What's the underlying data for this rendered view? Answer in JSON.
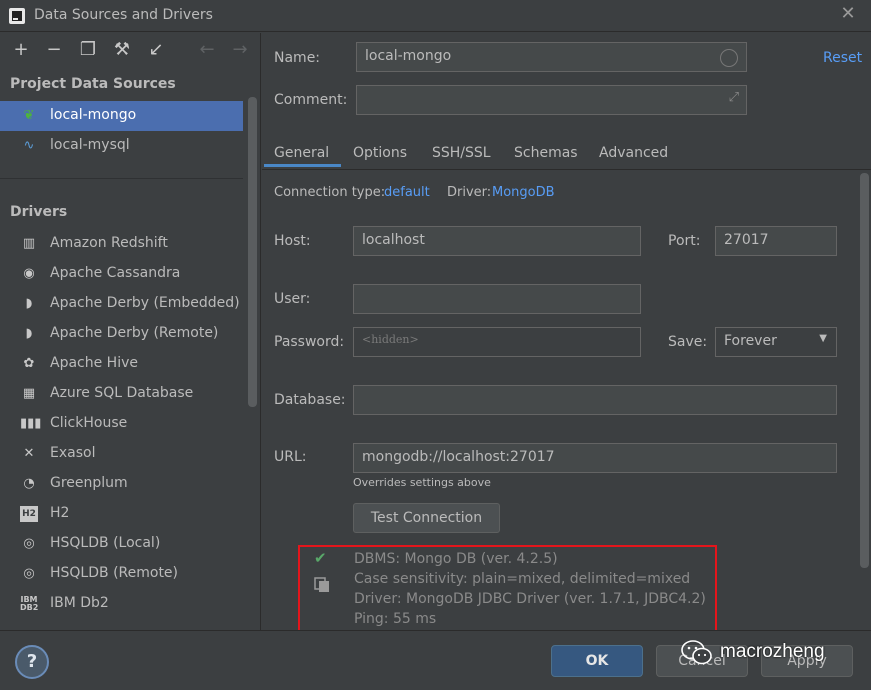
{
  "window": {
    "title": "Data Sources and Drivers",
    "close_icon": "close-icon"
  },
  "toolbar": {
    "icons": [
      "add-icon",
      "remove-icon",
      "copy-icon",
      "wrench-icon",
      "import-icon",
      "back-arrow-icon",
      "forward-arrow-icon"
    ]
  },
  "sidebar": {
    "project_heading": "Project Data Sources",
    "sources": [
      {
        "label": "local-mongo",
        "icon": "mongodb-leaf-icon",
        "selected": true
      },
      {
        "label": "local-mysql",
        "icon": "mysql-dolphin-icon",
        "selected": false
      }
    ],
    "drivers_heading": "Drivers",
    "drivers": [
      {
        "label": "Amazon Redshift",
        "icon": "redshift-icon"
      },
      {
        "label": "Apache Cassandra",
        "icon": "cassandra-icon"
      },
      {
        "label": "Apache Derby (Embedded)",
        "icon": "derby-icon"
      },
      {
        "label": "Apache Derby (Remote)",
        "icon": "derby-icon"
      },
      {
        "label": "Apache Hive",
        "icon": "hive-icon"
      },
      {
        "label": "Azure SQL Database",
        "icon": "azure-icon"
      },
      {
        "label": "ClickHouse",
        "icon": "clickhouse-icon"
      },
      {
        "label": "Exasol",
        "icon": "exasol-icon"
      },
      {
        "label": "Greenplum",
        "icon": "greenplum-icon"
      },
      {
        "label": "H2",
        "icon": "h2-icon"
      },
      {
        "label": "HSQLDB (Local)",
        "icon": "hsqldb-icon"
      },
      {
        "label": "HSQLDB (Remote)",
        "icon": "hsqldb-icon"
      },
      {
        "label": "IBM Db2",
        "icon": "ibm-db2-icon"
      }
    ]
  },
  "form": {
    "name_label": "Name:",
    "name_value": "local-mongo",
    "reset_label": "Reset",
    "comment_label": "Comment:",
    "comment_value": "",
    "tabs": [
      "General",
      "Options",
      "SSH/SSL",
      "Schemas",
      "Advanced"
    ],
    "active_tab": "General",
    "connection_type_label": "Connection type:",
    "connection_type_value": "default",
    "driver_label": "Driver:",
    "driver_value": "MongoDB",
    "host_label": "Host:",
    "host_value": "localhost",
    "port_label": "Port:",
    "port_value": "27017",
    "user_label": "User:",
    "user_value": "",
    "password_label": "Password:",
    "password_placeholder": "<hidden>",
    "save_label": "Save:",
    "save_value": "Forever",
    "database_label": "Database:",
    "database_value": "",
    "url_label": "URL:",
    "url_value": "mongodb://localhost:27017",
    "url_note": "Overrides settings above",
    "test_button": "Test Connection"
  },
  "result": {
    "status_icon": "check-icon",
    "lines": [
      "DBMS: Mongo DB (ver. 4.2.5)",
      "Case sensitivity: plain=mixed, delimited=mixed",
      "Driver: MongoDB JDBC Driver (ver. 1.7.1, JDBC4.2)",
      "Ping: 55 ms"
    ],
    "highlight_color": "#e5151b"
  },
  "footer": {
    "help_label": "?",
    "ok_label": "OK",
    "cancel_label": "Cancel",
    "apply_label": "Apply",
    "watermark": "macrozheng"
  }
}
